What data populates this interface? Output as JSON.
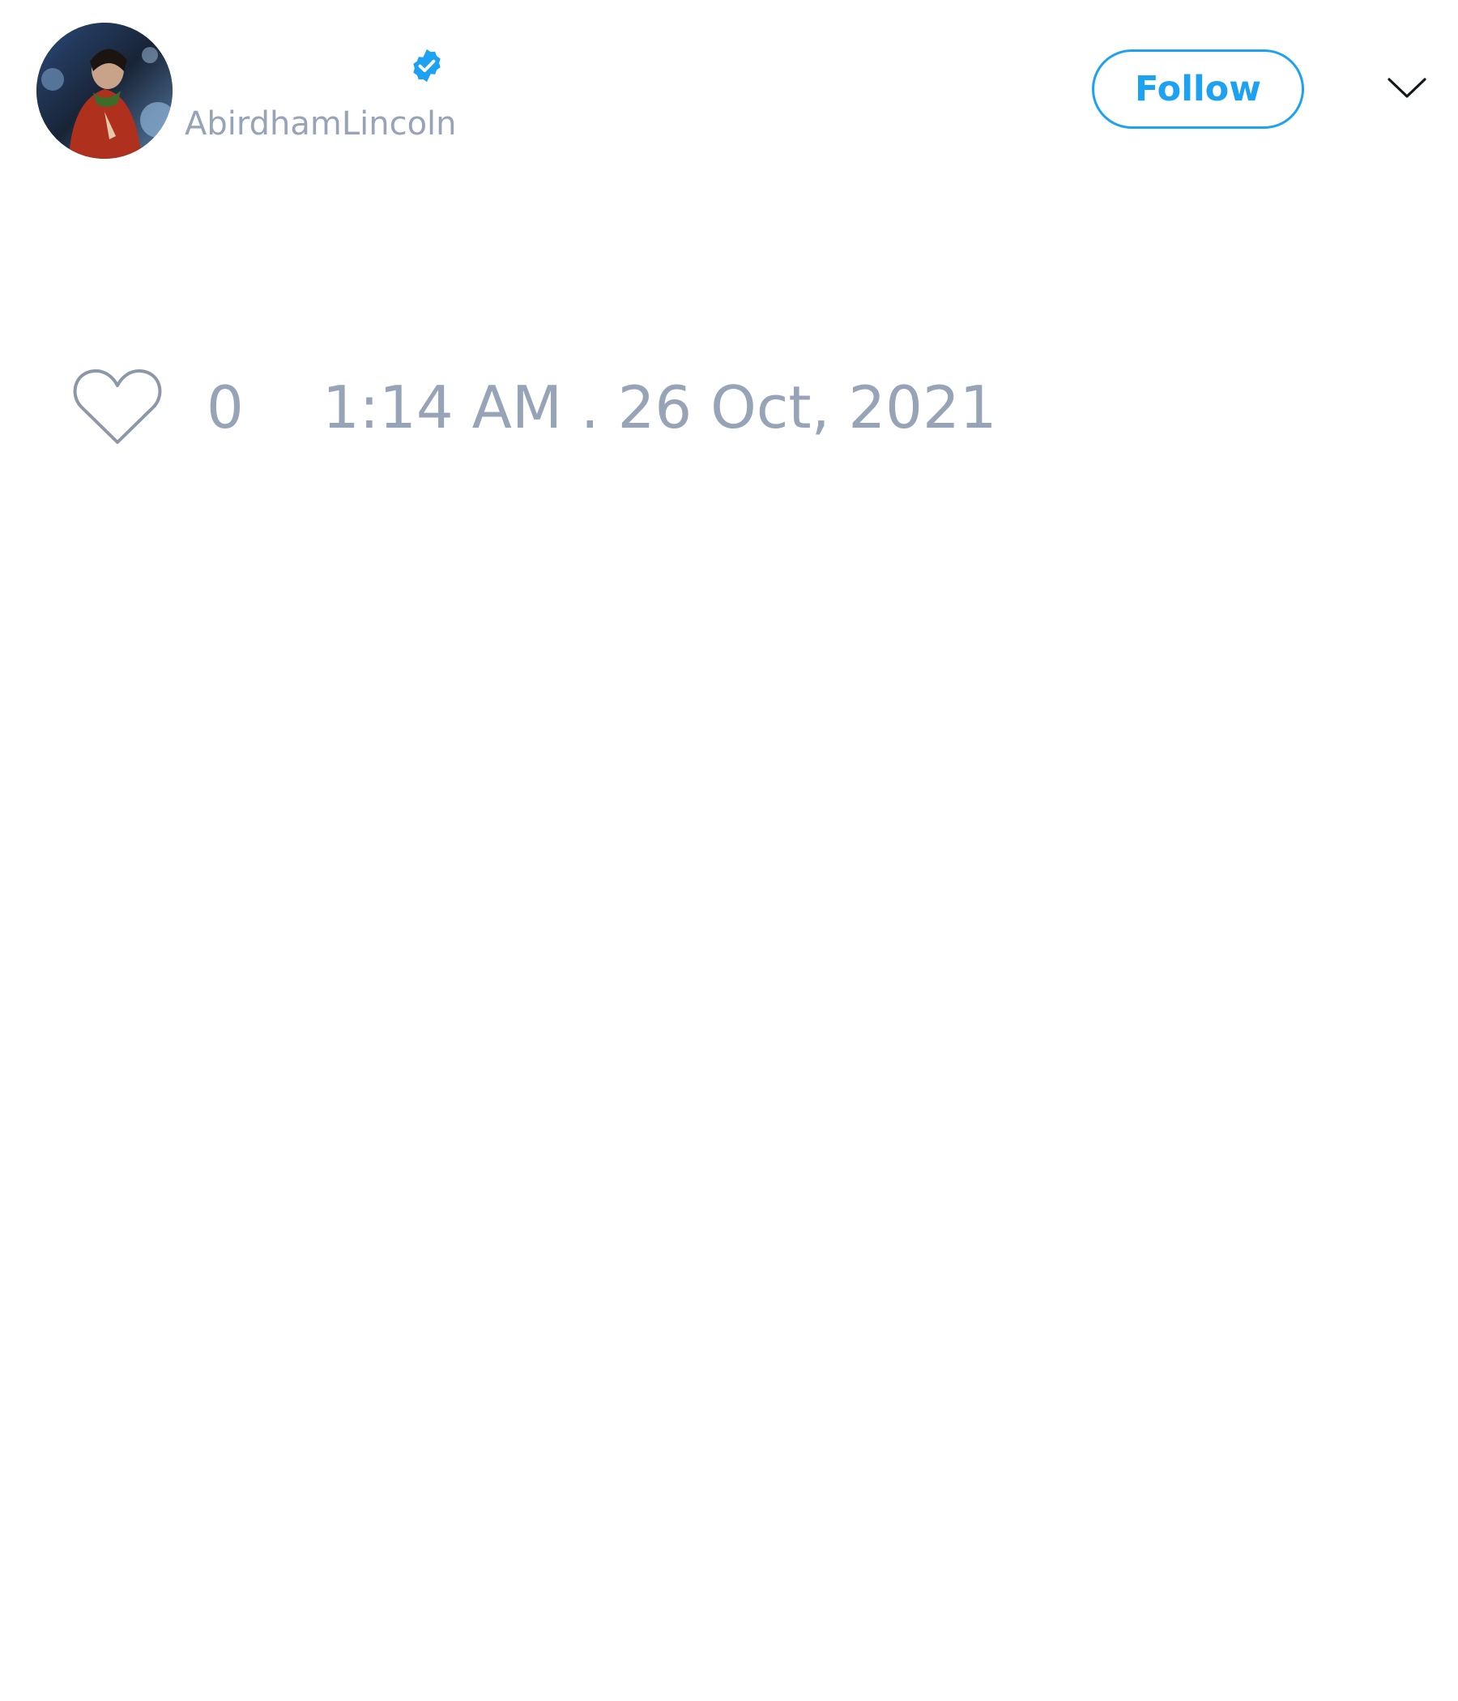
{
  "tweet": {
    "author": {
      "avatar_icon": "profile-photo",
      "verified_icon": "verified-badge-icon",
      "handle": "AbirdhamLincoln"
    },
    "follow_label": "Follow",
    "menu_icon": "chevron-down-icon",
    "like_icon": "heart-outline-icon",
    "like_count": "0",
    "timestamp": "1:14 AM . 26 Oct, 2021"
  },
  "colors": {
    "accent": "#1da1f2",
    "muted_text": "#97a4b7",
    "background": "#ffffff"
  }
}
